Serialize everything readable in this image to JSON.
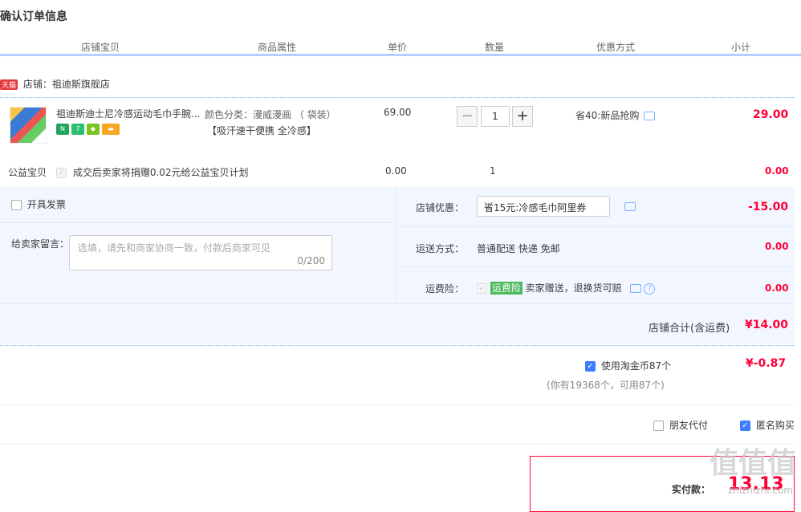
{
  "page_title": "确认订单信息",
  "columns": [
    "店铺宝贝",
    "商品属性",
    "单价",
    "数量",
    "优惠方式",
    "小计"
  ],
  "shop": {
    "badge": "天猫",
    "label": "店铺：祖迪斯旗舰店"
  },
  "item": {
    "name": "祖迪斯迪士尼冷感运动毛巾手腕...",
    "attr_color": "颜色分类：漫威漫画 （ 袋装）",
    "attr_tags": "【吸汗速干便携 全冷感】",
    "price": "69.00",
    "quantity": "1",
    "promo": "省40:新品抢购",
    "subtotal": "29.00"
  },
  "charity": {
    "label": "公益宝贝",
    "text": "成交后卖家将捐赠0.02元给公益宝贝计划",
    "price": "0.00",
    "quantity": "1",
    "subtotal": "0.00"
  },
  "invoice_label": "开具发票",
  "message": {
    "label": "给卖家留言：",
    "placeholder": "选填，请先和商家协商一致，付款后商家可见",
    "counter": "0/200"
  },
  "shop_coupon": {
    "label": "店铺优惠：",
    "selected": "省15元:冷感毛巾阿里券",
    "amount": "-15.00"
  },
  "shipping": {
    "label": "运送方式：",
    "value": "普通配送 快递 免邮",
    "amount": "0.00"
  },
  "insurance": {
    "label": "运费险：",
    "tag": "运费险",
    "text": "卖家赠送，退换货可赔",
    "amount": "0.00"
  },
  "shop_total": {
    "label": "店铺合计(含运费)",
    "amount": "¥14.00"
  },
  "coins": {
    "label": "使用淘金币87个",
    "sub": "(你有19368个，可用87个)",
    "amount": "¥-0.87"
  },
  "friend_pay": "朋友代付",
  "anonymous": "匿名购买",
  "pay": {
    "label": "实付款：",
    "amount": "13.13"
  },
  "watermark": {
    "main": "值值值",
    "sub": "zhizhizhi.com"
  },
  "colors": {
    "accent_red": "#ff0036",
    "header_line": "#b2d1ff",
    "panel_bg": "#f2f7ff"
  }
}
